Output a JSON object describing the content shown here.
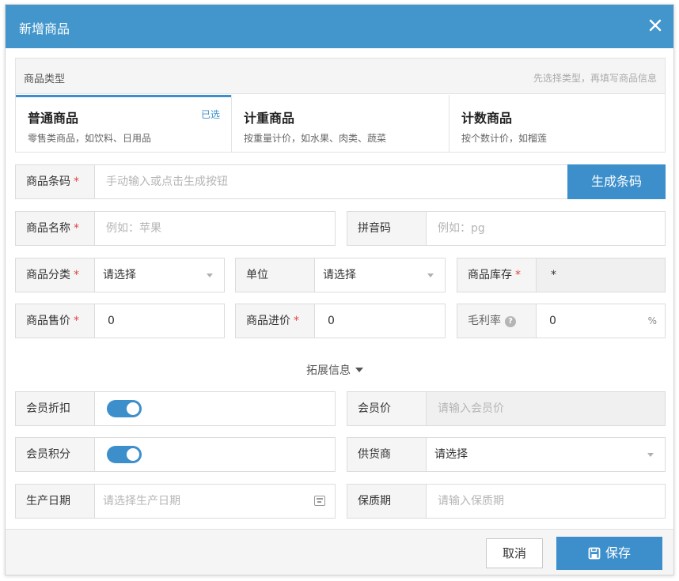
{
  "dialog": {
    "title": "新增商品",
    "close_icon": "close-icon"
  },
  "type_panel": {
    "label": "商品类型",
    "hint": "先选择类型，再填写商品信息",
    "types": [
      {
        "name": "普通商品",
        "desc": "零售类商品，如饮料、日用品",
        "selected_label": "已选",
        "selected": true
      },
      {
        "name": "计重商品",
        "desc": "按重量计价，如水果、肉类、蔬菜",
        "selected": false
      },
      {
        "name": "计数商品",
        "desc": "按个数计价，如榴莲",
        "selected": false
      }
    ]
  },
  "form": {
    "barcode": {
      "label": "商品条码",
      "required_mark": "*",
      "placeholder": "手动输入或点击生成按钮",
      "button": "生成条码"
    },
    "name": {
      "label": "商品名称",
      "required_mark": "*",
      "placeholder": "例如：苹果"
    },
    "pinyin": {
      "label": "拼音码",
      "placeholder": "例如：pg"
    },
    "category": {
      "label": "商品分类",
      "required_mark": "*",
      "value": "请选择"
    },
    "unit": {
      "label": "单位",
      "value": "请选择"
    },
    "stock": {
      "label": "商品库存",
      "required_mark": "*",
      "value": "*"
    },
    "price": {
      "label": "商品售价",
      "required_mark": "*",
      "value": "0"
    },
    "cost": {
      "label": "商品进价",
      "required_mark": "*",
      "value": "0"
    },
    "margin": {
      "label": "毛利率",
      "help_icon": "question-icon",
      "value": "0",
      "unit": "%"
    }
  },
  "extension": {
    "toggle_label": "拓展信息",
    "member_discount": {
      "label": "会员折扣",
      "enabled": true
    },
    "member_price": {
      "label": "会员价",
      "placeholder": "请输入会员价"
    },
    "member_points": {
      "label": "会员积分",
      "enabled": true
    },
    "supplier": {
      "label": "供货商",
      "value": "请选择"
    },
    "production_date": {
      "label": "生产日期",
      "placeholder": "请选择生产日期",
      "icon": "calendar-icon"
    },
    "shelf_life": {
      "label": "保质期",
      "placeholder": "请输入保质期"
    }
  },
  "footer": {
    "cancel_label": "取消",
    "save_label": "保存",
    "save_icon": "save-icon"
  }
}
